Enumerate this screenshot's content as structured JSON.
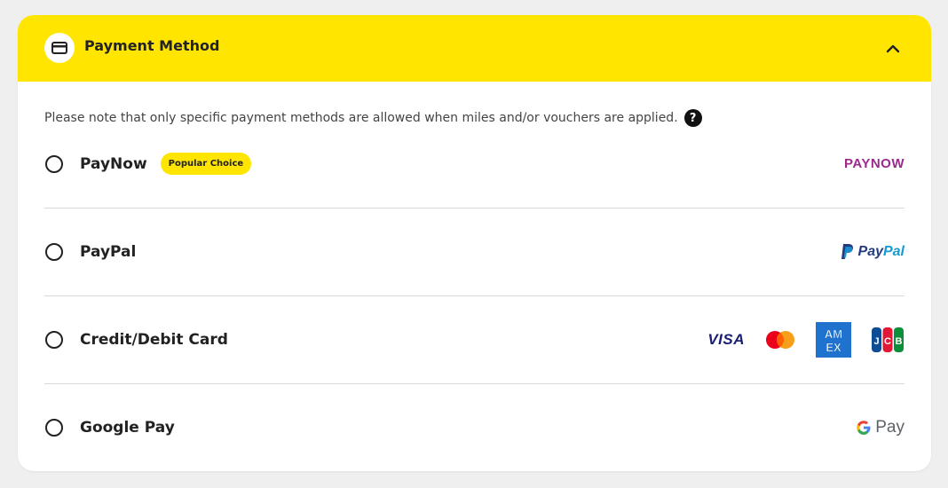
{
  "header": {
    "title": "Payment Method",
    "icon": "credit-card-icon",
    "collapse_icon": "chevron-up-icon",
    "background": "#ffe500"
  },
  "note": {
    "text": "Please note that only specific payment methods are allowed when miles and/or vouchers are applied.",
    "help_glyph": "?"
  },
  "options": [
    {
      "label": "PayNow",
      "badge": "Popular Choice",
      "logo_text": "PAYNOW",
      "selected": false
    },
    {
      "label": "PayPal",
      "logo_text_a": "Pay",
      "logo_text_b": "Pal",
      "selected": false
    },
    {
      "label": "Credit/Debit Card",
      "logos": [
        "VISA",
        "mastercard",
        "AMEX",
        "JCB"
      ],
      "visa_text": "VISA",
      "selected": false
    },
    {
      "label": "Google Pay",
      "logo_text": "Pay",
      "selected": false
    }
  ],
  "colors": {
    "accent": "#ffe500",
    "paynow": "#9b2a8c",
    "paypal_dark": "#253b80",
    "paypal_light": "#179bd7",
    "visa": "#1a1f71",
    "amex": "#1f72cd"
  }
}
